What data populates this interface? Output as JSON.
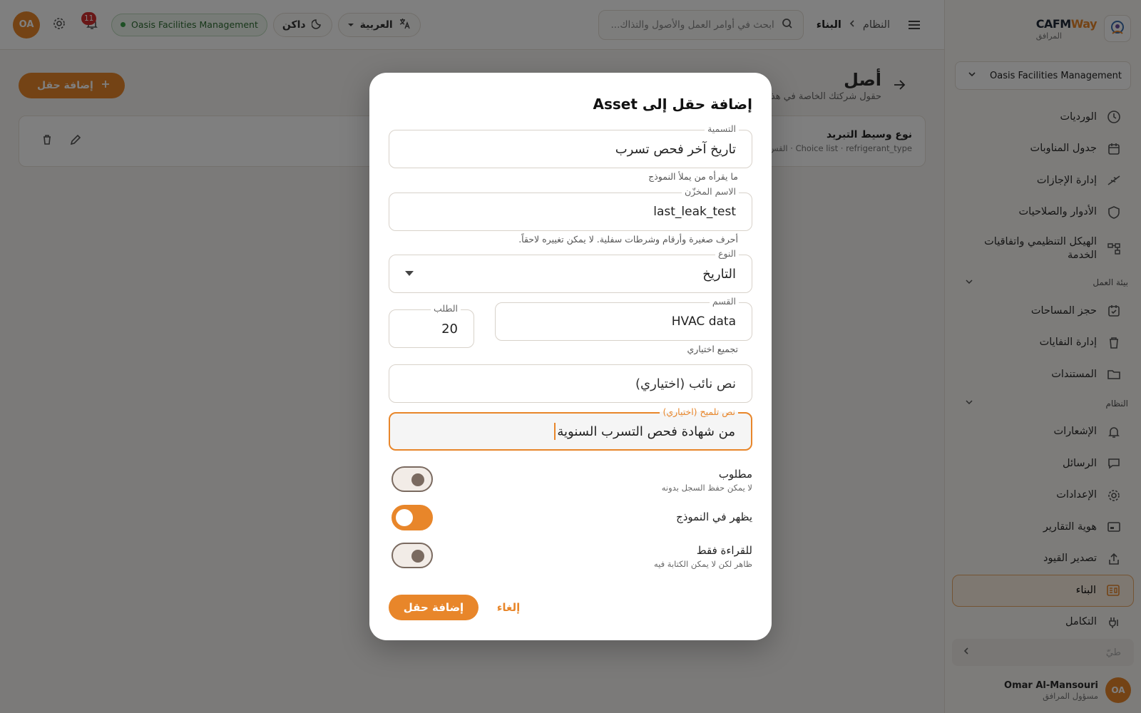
{
  "brand": {
    "name_a": "CAFM",
    "name_b": "Way",
    "subtitle": "المرافق"
  },
  "sidebar": {
    "org_select": "Oasis Facilities Management",
    "items_top": [
      {
        "label": "الورديات",
        "icon": "clock-icon"
      },
      {
        "label": "جدول المناوبات",
        "icon": "calendar-icon"
      },
      {
        "label": "إدارة الإجازات",
        "icon": "plane-icon"
      },
      {
        "label": "الأدوار والصلاحيات",
        "icon": "shield-icon"
      },
      {
        "label": "الهيكل التنظيمي واتفاقيات الخدمة",
        "icon": "org-chart-icon"
      }
    ],
    "section_workspace": "بيئة العمل",
    "items_workspace": [
      {
        "label": "حجز المساحات",
        "icon": "calendar-check-icon"
      },
      {
        "label": "إدارة النفايات",
        "icon": "trash-icon"
      },
      {
        "label": "المستندات",
        "icon": "folder-icon"
      }
    ],
    "section_system": "النظام",
    "items_system": [
      {
        "label": "الإشعارات",
        "icon": "bell-icon"
      },
      {
        "label": "الرسائل",
        "icon": "chat-icon"
      },
      {
        "label": "الإعدادات",
        "icon": "gear-icon"
      },
      {
        "label": "هوية التقارير",
        "icon": "report-icon"
      },
      {
        "label": "تصدير القيود",
        "icon": "export-icon"
      },
      {
        "label": "البناء",
        "icon": "builder-icon",
        "active": true
      },
      {
        "label": "التكامل",
        "icon": "integration-icon"
      }
    ],
    "collapse_label": "طيّ",
    "user": {
      "name": "Omar Al-Mansouri",
      "role": "مسؤول المرافق",
      "initials": "OA"
    }
  },
  "topbar": {
    "breadcrumb_root": "النظام",
    "breadcrumb_current": "البناء",
    "search_placeholder": "ابحث في أوامر العمل والأصول والتذاك...",
    "language": "العربية",
    "theme": "داكن",
    "org_badge": "Oasis Facilities Management",
    "notifications_count": "11",
    "user_initials": "OA"
  },
  "page": {
    "title": "أصل",
    "subtitle": "حقول شركتك الخاصة في هذا",
    "add_button": "إضافة حقل",
    "field_card": {
      "name": "نوع وسيط التبريد",
      "type": "Choice list",
      "key": "refrigerant_type",
      "section": "القس"
    }
  },
  "dialog": {
    "title": "إضافة حقل إلى Asset",
    "label_field": {
      "label": "التسمية",
      "value": "تاريخ آخر فحص تسرب",
      "helper": "ما يقرأه من يملأ النموذج"
    },
    "key_field": {
      "label": "الاسم المخزّن",
      "value": "last_leak_test",
      "helper": "أحرف صغيرة وأرقام وشرطات سفلية. لا يمكن تغييره لاحقاً."
    },
    "type_field": {
      "label": "النوع",
      "value": "التاريخ"
    },
    "section_field": {
      "label": "القسم",
      "value": "HVAC data",
      "helper": "تجميع اختياري"
    },
    "order_field": {
      "label": "الطلب",
      "value": "20"
    },
    "placeholder_field": {
      "value": "نص نائب (اختياري)"
    },
    "hint_field": {
      "label": "نص تلميح (اختياري)",
      "value": "من شهادة فحص التسرب السنوية"
    },
    "toggles": {
      "required": {
        "label": "مطلوب",
        "sub": "لا يمكن حفظ السجل بدونه",
        "on": false
      },
      "show_in_form": {
        "label": "يظهر في النموذج",
        "on": true
      },
      "read_only": {
        "label": "للقراءة فقط",
        "sub": "ظاهر لكن لا يمكن الكتابة فيه",
        "on": false
      }
    },
    "submit": "إضافة حقل",
    "cancel": "إلغاء"
  },
  "colors": {
    "accent": "#e8862a",
    "active_bg": "#fdf1e3",
    "badge": "#d32f2f",
    "org_green": "#3da04a"
  }
}
